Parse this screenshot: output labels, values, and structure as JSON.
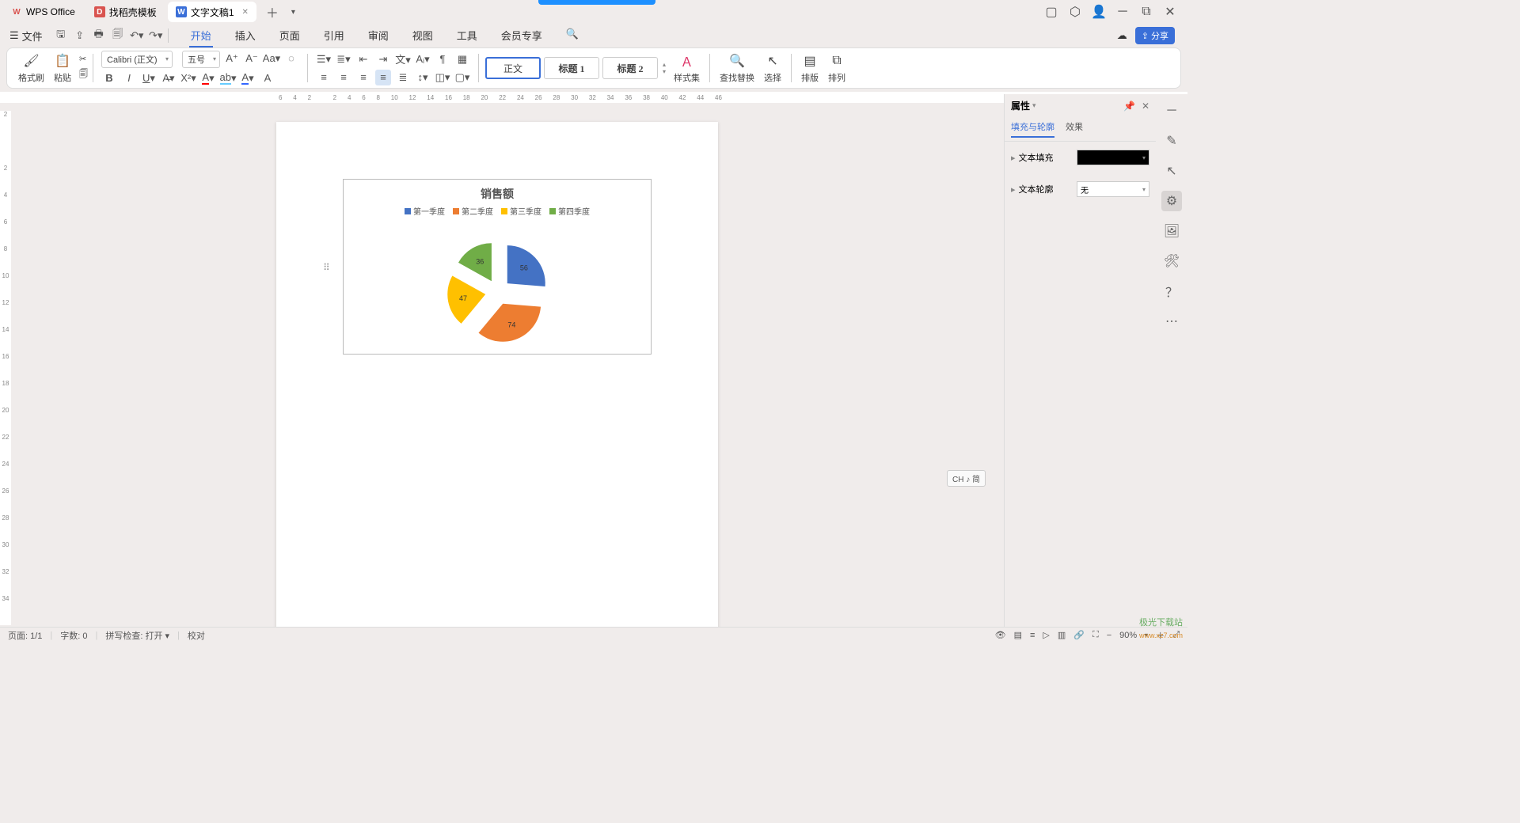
{
  "tabs": {
    "t1": {
      "label": "WPS Office"
    },
    "t2": {
      "label": "找稻壳模板"
    },
    "t3": {
      "label": "文字文稿1"
    }
  },
  "menubar": {
    "file": "文件",
    "items": [
      "开始",
      "插入",
      "页面",
      "引用",
      "审阅",
      "视图",
      "工具",
      "会员专享"
    ]
  },
  "share": "分享",
  "ribbon": {
    "fmtpaint": "格式刷",
    "paste": "粘贴",
    "font": "Calibri (正文)",
    "size": "五号",
    "styles": {
      "normal": "正文",
      "h1": "标题 1",
      "h2": "标题 2"
    },
    "styleset": "样式集",
    "findrep": "查找替换",
    "select": "选择",
    "layout": "排版",
    "arrange": "排列"
  },
  "ruler_h": [
    "6",
    "4",
    "2",
    "",
    "2",
    "4",
    "6",
    "8",
    "10",
    "12",
    "14",
    "16",
    "18",
    "20",
    "22",
    "24",
    "26",
    "28",
    "30",
    "32",
    "34",
    "36",
    "38",
    "40",
    "42",
    "44",
    "46"
  ],
  "ruler_v": [
    "2",
    "",
    "2",
    "4",
    "6",
    "8",
    "10",
    "12",
    "14",
    "16",
    "18",
    "20",
    "22",
    "24",
    "26",
    "28",
    "30",
    "32",
    "34"
  ],
  "chart_data": {
    "type": "pie",
    "title": "销售额",
    "series": [
      {
        "name": "第一季度",
        "value": 56,
        "color": "#4472c4"
      },
      {
        "name": "第二季度",
        "value": 74,
        "color": "#ed7d31"
      },
      {
        "name": "第三季度",
        "value": 47,
        "color": "#ffc000"
      },
      {
        "name": "第四季度",
        "value": 36,
        "color": "#70ad47"
      }
    ]
  },
  "sidepanel": {
    "title": "属性",
    "tab_fill": "填充与轮廓",
    "tab_effect": "效果",
    "text_fill": "文本填充",
    "text_outline": "文本轮廓",
    "outline_value": "无"
  },
  "ime": "CH ♪ 简",
  "status": {
    "page": "页面: 1/1",
    "words": "字数: 0",
    "spell": "拼写检查: 打开",
    "proof": "校对",
    "zoom": "90%"
  },
  "watermark": {
    "a": "极光下载站",
    "b": "www.xz7.com"
  }
}
